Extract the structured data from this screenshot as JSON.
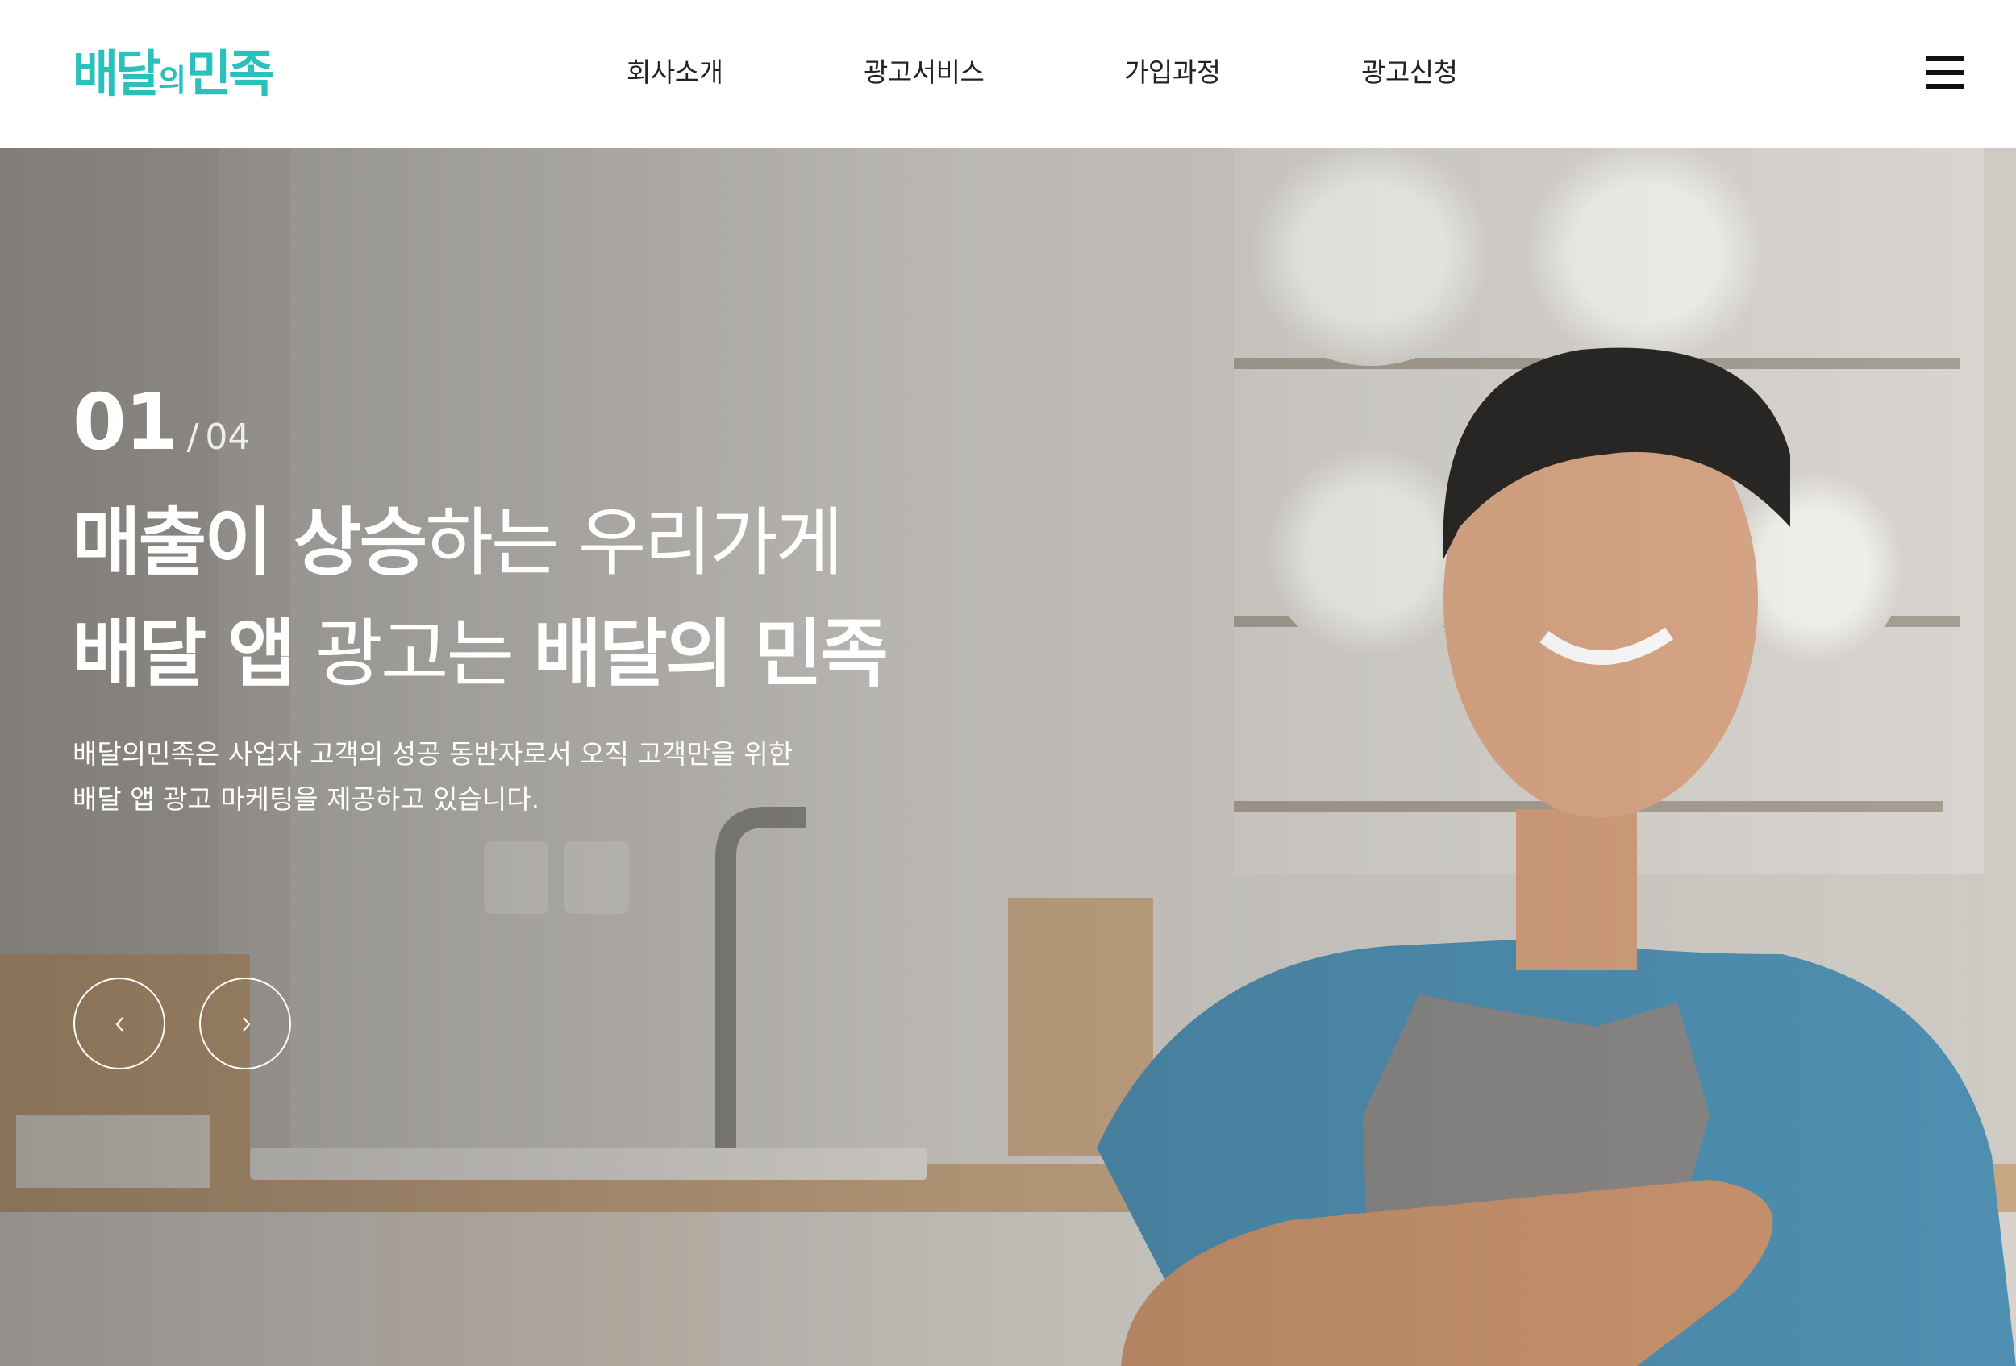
{
  "brand": {
    "logo_main": "배달",
    "logo_small": "의",
    "logo_end": "민족",
    "color": "#2ac1bc"
  },
  "nav": {
    "items": [
      {
        "label": "회사소개"
      },
      {
        "label": "광고서비스"
      },
      {
        "label": "가입과정"
      },
      {
        "label": "광고신청"
      }
    ],
    "menu_icon": "hamburger-icon"
  },
  "hero": {
    "slide_current": "01",
    "slide_separator": "/",
    "slide_total": "04",
    "headline_line1_bold": "매출이 상승",
    "headline_line1_light": "하는 우리가게",
    "headline_line2_bold1": "배달 앱",
    "headline_line2_light": " 광고는 ",
    "headline_line2_bold2": "배달의 민족",
    "desc_line1": "배달의민족은 사업자 고객의 성공 동반자로서 오직 고객만을 위한",
    "desc_line2": "배달 앱 광고 마케팅을 제공하고 있습니다.",
    "prev_icon": "chevron-left-icon",
    "next_icon": "chevron-right-icon"
  }
}
